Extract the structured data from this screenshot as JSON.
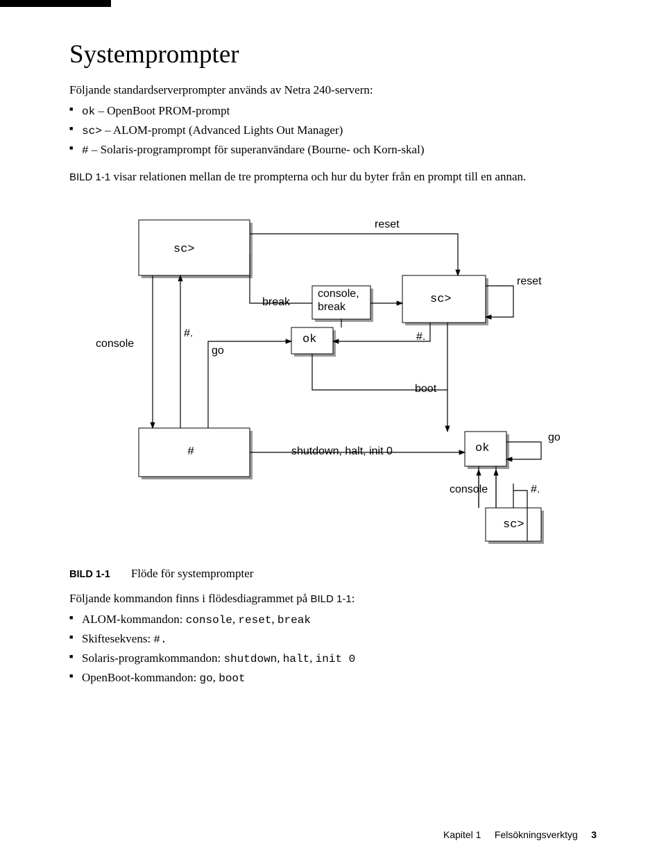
{
  "title": "Systemprompter",
  "intro": "Följande standardserverprompter används av Netra 240-servern:",
  "bullet1_code": "ok",
  "bullet1_text": " – OpenBoot PROM-prompt",
  "bullet2_code": "sc>",
  "bullet2_text": " – ALOM-prompt (Advanced Lights Out Manager)",
  "bullet3_code": "#",
  "bullet3_text": " – Solaris-programprompt för superanvändare (Bourne- och Korn-skal)",
  "para2_pre": "BILD 1-1",
  "para2_post": " visar relationen mellan de tre prompterna och hur du byter från en prompt till en annan.",
  "dia": {
    "sc1": "sc>",
    "sc2": "sc>",
    "sc3": "sc>",
    "ok1": "ok",
    "ok2": "ok",
    "hash": "#",
    "reset1": "reset",
    "reset2": "reset",
    "break1": "break",
    "console_break": "console,\nbreak",
    "hashdot1": "#.",
    "hashdot2": "#.",
    "hashdot3": "#.",
    "go1": "go",
    "go2": "go",
    "console1": "console",
    "console2": "console",
    "boot": "boot",
    "shutdown": "shutdown, halt, init 0"
  },
  "fig_tag": "BILD 1-1",
  "fig_caption": "Flöde för systemprompter",
  "para3_pre": "Följande kommandon finns i flödesdiagrammet på ",
  "para3_ref": "BILD 1-1",
  "para3_post": ":",
  "b4_pre": "ALOM-kommandon: ",
  "b4_code": "console",
  "b4_mid1": ", ",
  "b4_code2": "reset",
  "b4_mid2": ", ",
  "b4_code3": "break",
  "b5_pre": "Skiftesekvens: ",
  "b5_code": "#.",
  "b6_pre": "Solaris-programkommandon: ",
  "b6_code": "shutdown",
  "b6_mid1": ", ",
  "b6_code2": "halt",
  "b6_mid2": ", ",
  "b6_code3": "init 0",
  "b7_pre": "OpenBoot-kommandon: ",
  "b7_code": "go",
  "b7_mid": ", ",
  "b7_code2": "boot",
  "footer_chapter": "Kapitel 1",
  "footer_title": "Felsökningsverktyg",
  "footer_page": "3"
}
